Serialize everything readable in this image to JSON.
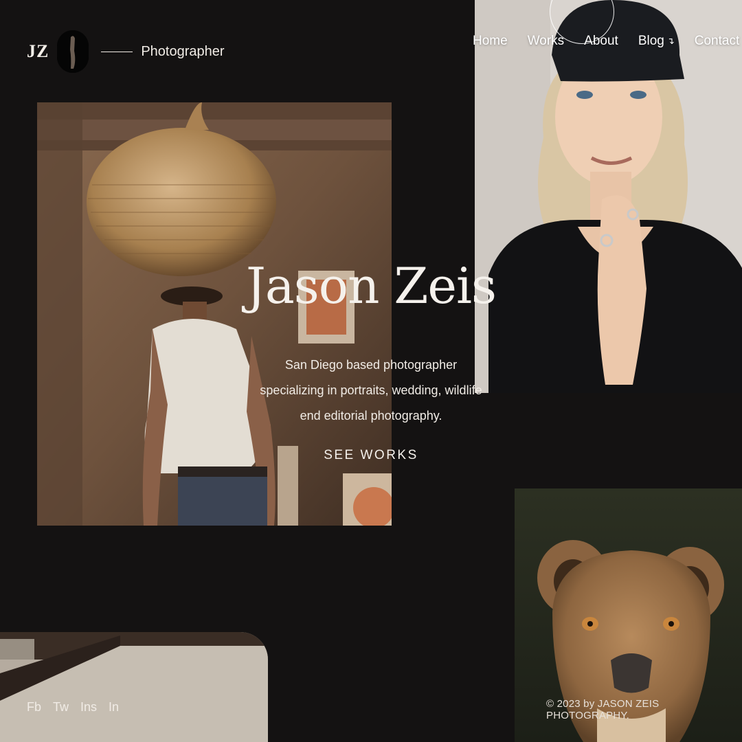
{
  "brand": {
    "initials": "JZ",
    "role": "Photographer"
  },
  "nav": {
    "items": [
      {
        "label": "Home"
      },
      {
        "label": "Works"
      },
      {
        "label": "About"
      },
      {
        "label": "Blog"
      },
      {
        "label": "Contact"
      }
    ],
    "blog_arrow": "↴"
  },
  "hero": {
    "name": "Jason Zeis",
    "description": "San Diego based photographer specializing in portraits, wedding, wildlife end editorial photography.",
    "cta": "SEE WORKS"
  },
  "social": {
    "items": [
      {
        "label": "Fb"
      },
      {
        "label": "Tw"
      },
      {
        "label": "Ins"
      },
      {
        "label": "In"
      }
    ]
  },
  "footer": {
    "copyright": "© 2023 by JASON ZEIS PHOTOGRAPHY."
  },
  "colors": {
    "background": "#141212",
    "text": "#f1ece6"
  }
}
